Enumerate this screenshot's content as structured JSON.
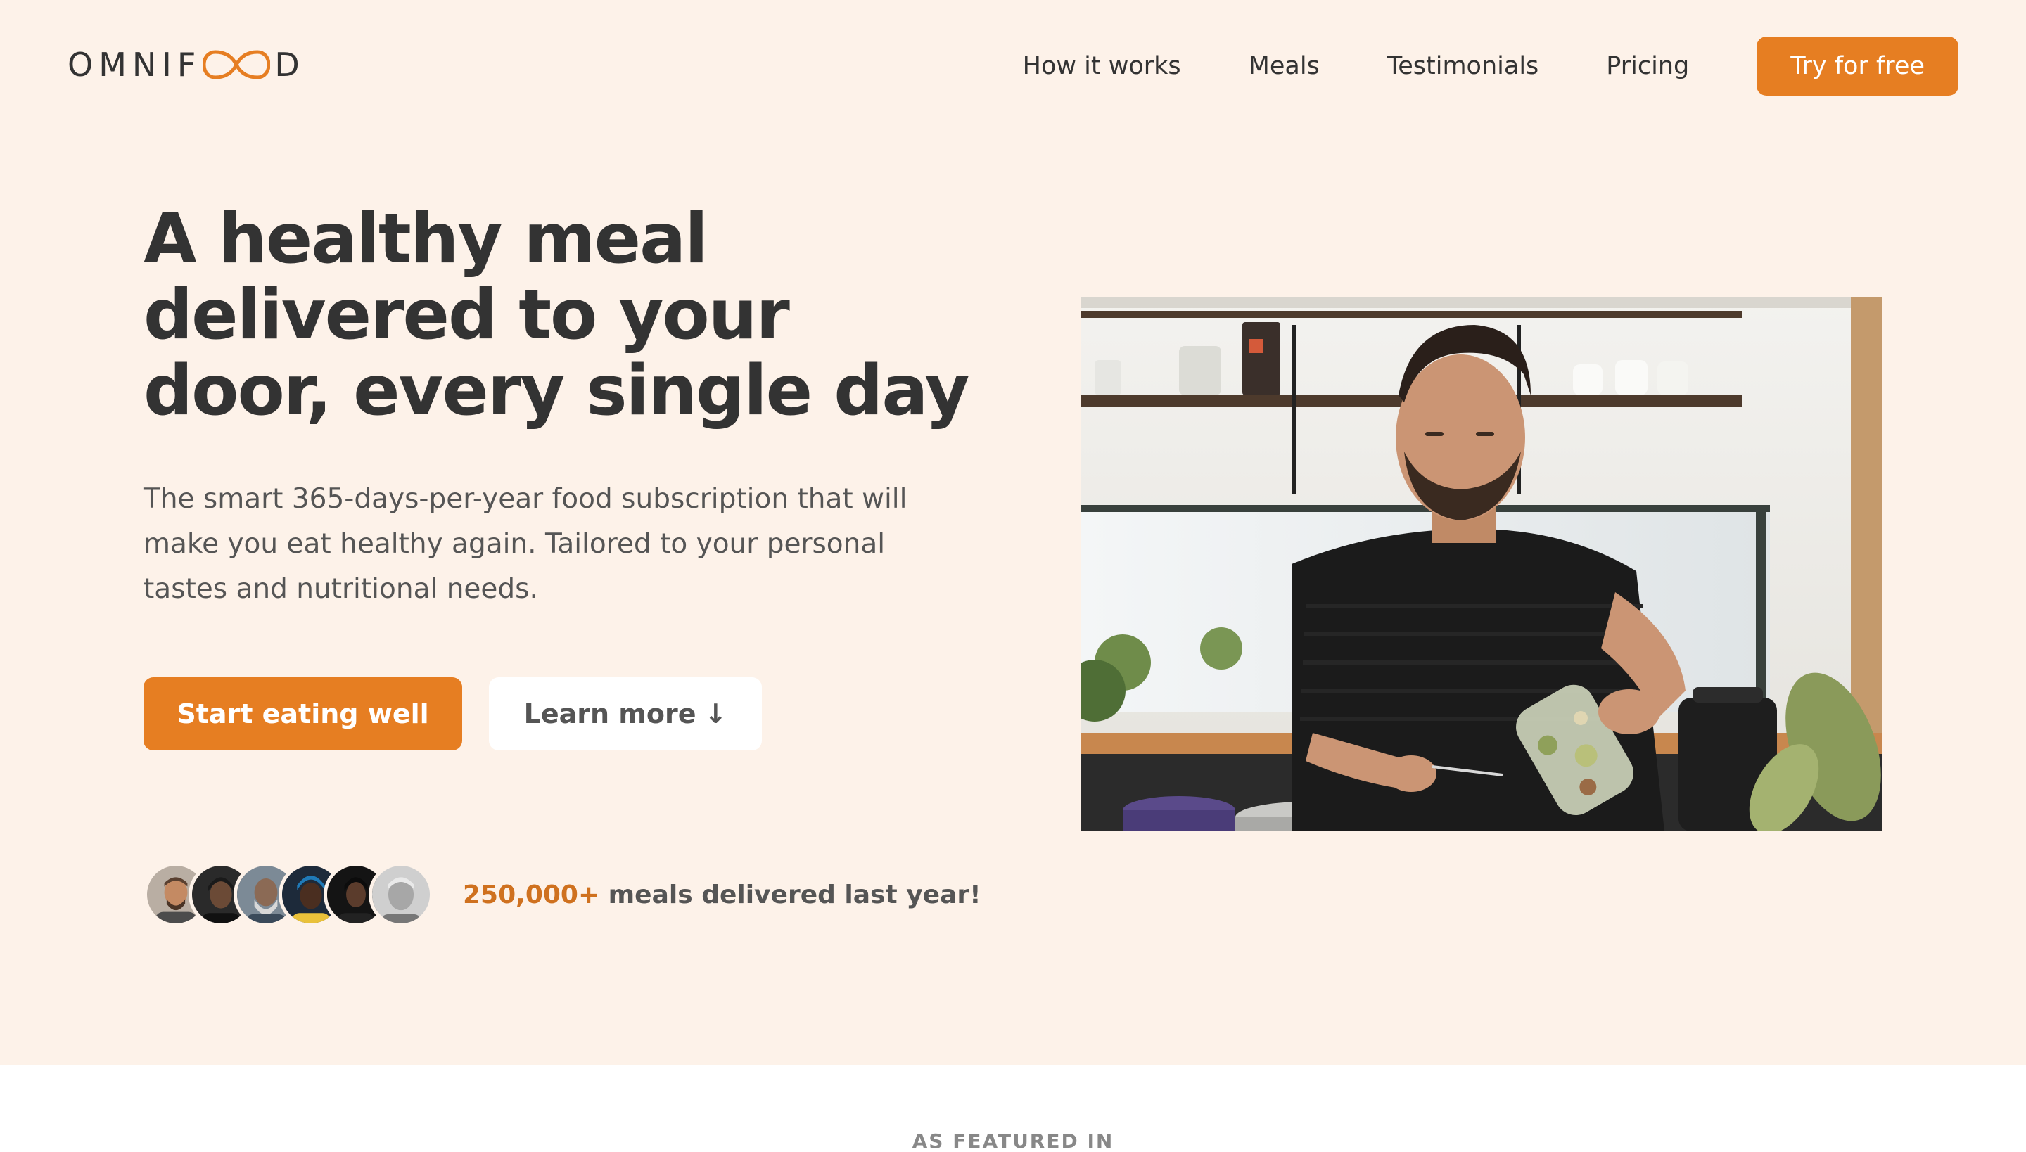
{
  "header": {
    "logo_text_start": "OMNIF",
    "logo_text_end": "D",
    "nav": [
      {
        "label": "How it works"
      },
      {
        "label": "Meals"
      },
      {
        "label": "Testimonials"
      },
      {
        "label": "Pricing"
      }
    ],
    "cta_label": "Try for free"
  },
  "hero": {
    "title_line_1": "A healthy meal",
    "title_line_2": "delivered to your",
    "title_line_3": "door, every single day",
    "description": "The smart 365-days-per-year food subscription that will make you eat healthy again. Tailored to your personal tastes and nutritional needs.",
    "primary_button": "Start eating well",
    "secondary_button": "Learn more",
    "secondary_button_arrow": "↓",
    "delivered_count": "250,000+",
    "delivered_text": " meals delivered last year!"
  },
  "featured": {
    "title": "AS FEATURED IN"
  },
  "colors": {
    "background": "#fdf2e9",
    "accent": "#e67e22",
    "accent_dark": "#cf711f",
    "text_dark": "#333333",
    "text_body": "#555555"
  },
  "icons": {
    "logo_mark": "infinity-o-icon",
    "learn_more_arrow": "arrow-down-icon"
  }
}
